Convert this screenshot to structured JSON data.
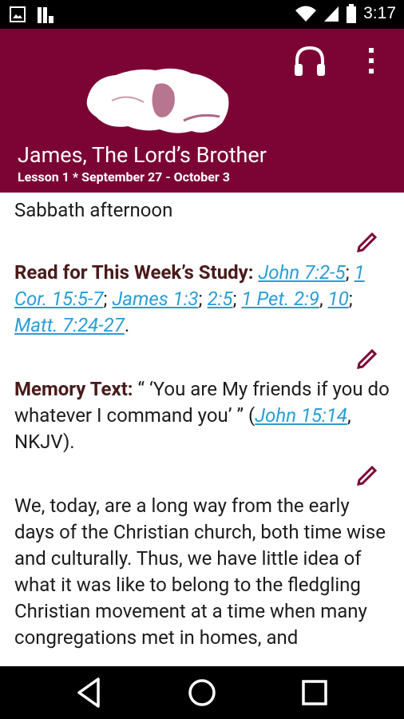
{
  "status_bar": {
    "time": "3:17",
    "icons_left": [
      "image-icon",
      "app-notification-icon"
    ],
    "icons_right": [
      "wifi-icon",
      "signal-icon",
      "battery-icon"
    ]
  },
  "app_bar": {
    "background": "#7c0434",
    "title": "James, The Lord’s Brother",
    "subtitle": "Lesson 1 * September 27 - October 3",
    "actions": [
      "headphones-icon",
      "more-vert-icon"
    ]
  },
  "content": {
    "heading": "Sabbath afternoon",
    "read": {
      "label": "Read for This Week’s Study:",
      "refs": [
        "John 7:2-5",
        "1 Cor. 15:5-7",
        "James 1:3",
        "2:5",
        "1 Pet. 2:9",
        "10",
        "Matt. 7:24-27"
      ]
    },
    "memory": {
      "label": "Memory Text:",
      "quote": " “ ‘You are My friends if you do whatever I command you’ ” (",
      "ref": "John 15:14",
      "suffix": ", NKJV)."
    },
    "body": "We, today, are a long way from the early days of the Christian church, both time wise and culturally. Thus, we have little idea of what it was like to belong to the fledgling Christian movement at a time when many congregations met in homes, and"
  },
  "nav_bar": {
    "buttons": [
      "back-icon",
      "home-icon",
      "recents-icon"
    ]
  },
  "colors": {
    "accent": "#7c0434",
    "link": "#2a9dd6",
    "label": "#4a1a1a"
  }
}
